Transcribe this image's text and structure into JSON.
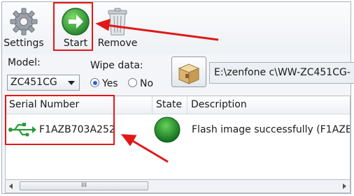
{
  "toolbar": {
    "settings_label": "Settings",
    "start_label": "Start",
    "remove_label": "Remove"
  },
  "options": {
    "model_label": "Model:",
    "model_value": "ZC451CG",
    "wipe_label": "Wipe data:",
    "wipe_yes": "Yes",
    "wipe_no": "No",
    "wipe_selected": "Yes",
    "path_value": "E:\\zenfone c\\WW-ZC451CG-"
  },
  "table": {
    "columns": [
      "Serial Number",
      "State",
      "Description"
    ],
    "rows": [
      {
        "serial": "F1AZB703A252",
        "state": "success",
        "description": "Flash image successfully (F1AZB7"
      }
    ]
  },
  "scrollbar": {
    "grip": "III"
  },
  "colors": {
    "annotation": "#e01818",
    "start_green": "#2e9d3a",
    "state_green": "#1f8f2a",
    "usb_green": "#2a9a3a"
  }
}
